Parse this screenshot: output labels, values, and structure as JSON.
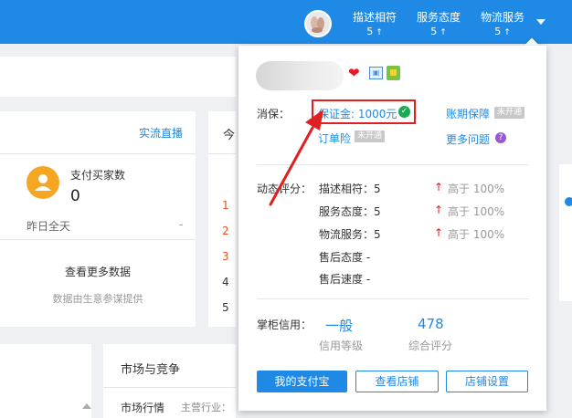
{
  "topbar": {
    "ratings": [
      {
        "label": "描述相符",
        "value": "5",
        "arrow": "↑"
      },
      {
        "label": "服务态度",
        "value": "5",
        "arrow": "↑"
      },
      {
        "label": "物流服务",
        "value": "5",
        "arrow": "↑"
      }
    ]
  },
  "background": {
    "live_link": "实流直播",
    "buyer_title": "支付买家数",
    "buyer_count": "0",
    "yesterday": "昨日全天",
    "dash": "-",
    "more_data": "查看更多数据",
    "data_source": "数据由生意参谋提供",
    "today_char": "今",
    "ranks": [
      "1",
      "2",
      "3",
      "4",
      "5"
    ],
    "market_title": "市场与竞争",
    "market_sub": "市场行情",
    "market_industry": "主营行业："
  },
  "panel": {
    "consumer_protection_label": "消保：",
    "deposit": "保证金: 1000元",
    "deposit_check": "✓",
    "account_guarantee": "账期保障",
    "not_opened": "未开通",
    "order_deposit": "订单险",
    "more_questions": "更多问题",
    "question_mark": "?",
    "dynamic_label": "动态评分：",
    "dynamic_items": [
      {
        "label": "描述相符：5",
        "arrow": "↑",
        "compare": "高于 100%"
      },
      {
        "label": "服务态度：5",
        "arrow": "↑",
        "compare": "高于 100%"
      },
      {
        "label": "物流服务：5",
        "arrow": "↑",
        "compare": "高于 100%"
      },
      {
        "label": "售后态度 -"
      },
      {
        "label": "售后速度 -"
      }
    ],
    "credit_label": "掌柜信用：",
    "credit_level": "一般",
    "credit_level_label": "信用等级",
    "score": "478",
    "score_label": "综合评分",
    "buttons": {
      "alipay": "我的支付宝",
      "view_shop": "查看店铺",
      "shop_settings": "店铺设置"
    }
  },
  "colors": {
    "brand_blue": "#1e8ae6",
    "highlight_red": "#e02020",
    "check_green": "#1aaa55"
  }
}
